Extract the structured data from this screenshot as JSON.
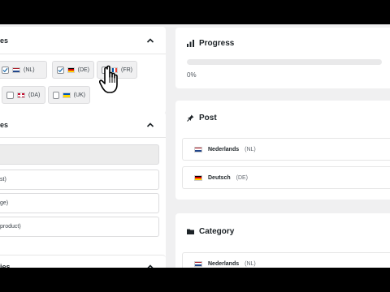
{
  "left": {
    "languages_panel": {
      "title": "es",
      "chips": [
        {
          "code": "(NL)",
          "checked": true,
          "flag": "nl"
        },
        {
          "code": "(DE)",
          "checked": true,
          "flag": "de"
        },
        {
          "code": "(FR)",
          "checked": false,
          "flag": "fr"
        },
        {
          "code": "(DA)",
          "checked": false,
          "flag": "dk"
        },
        {
          "code": "(UK)",
          "checked": false,
          "flag": "ua"
        }
      ]
    },
    "types_panel": {
      "title": "es",
      "options": [
        "",
        "st)",
        "ge)",
        "product)"
      ]
    },
    "bottom_panel": {
      "title": "ies"
    }
  },
  "right": {
    "progress": {
      "title": "Progress",
      "value": 0,
      "label": "0%"
    },
    "post": {
      "title": "Post",
      "rows": [
        {
          "name": "Nederlands",
          "code": "(NL)",
          "flag": "nl"
        },
        {
          "name": "Deutsch",
          "code": "(DE)",
          "flag": "de"
        }
      ]
    },
    "category": {
      "title": "Category",
      "rows": [
        {
          "name": "Nederlands",
          "code": "(NL)",
          "flag": "nl"
        }
      ]
    }
  },
  "colors": {
    "accent": "#2271b1",
    "background": "#f0f0f1",
    "panel": "#ffffff"
  }
}
